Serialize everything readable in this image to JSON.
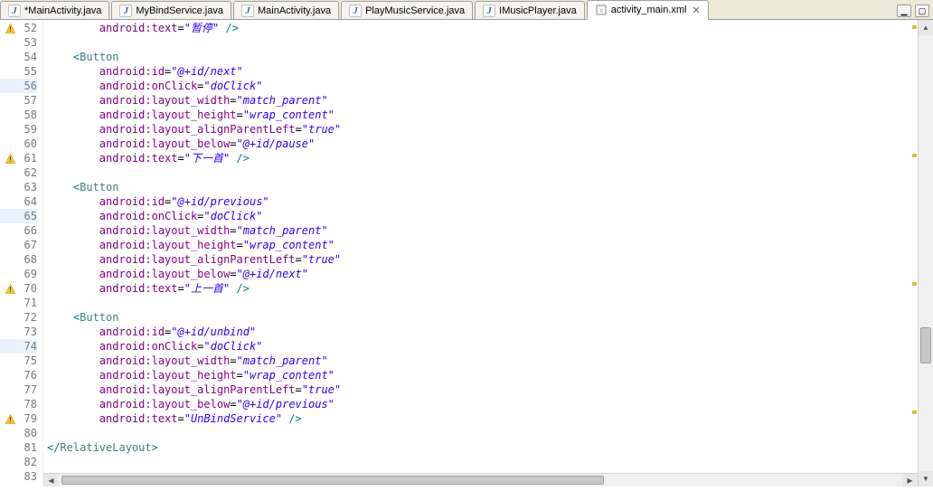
{
  "tabs": [
    {
      "label": "*MainActivity.java",
      "icon": "J",
      "active": false
    },
    {
      "label": "MyBindService.java",
      "icon": "J",
      "active": false
    },
    {
      "label": "MainActivity.java",
      "icon": "J",
      "active": false
    },
    {
      "label": "PlayMusicService.java",
      "icon": "J",
      "active": false
    },
    {
      "label": "IMusicPlayer.java",
      "icon": "J",
      "active": false
    },
    {
      "label": "activity_main.xml",
      "icon": "xml",
      "active": true
    }
  ],
  "gutter": {
    "start": 52,
    "end": 83,
    "warnings": [
      52,
      61,
      70,
      79
    ],
    "highlighted": [
      56,
      65,
      74
    ]
  },
  "code_lines": [
    {
      "n": 52,
      "indent": 8,
      "tokens": [
        [
          "attr",
          "android:text"
        ],
        [
          "eq",
          "="
        ],
        [
          "str",
          "\"暂停\""
        ],
        [
          "brk",
          " />"
        ]
      ]
    },
    {
      "n": 53,
      "indent": 0,
      "tokens": []
    },
    {
      "n": 54,
      "indent": 4,
      "tokens": [
        [
          "brk",
          "<"
        ],
        [
          "tag",
          "Button"
        ]
      ]
    },
    {
      "n": 55,
      "indent": 8,
      "tokens": [
        [
          "attr",
          "android:id"
        ],
        [
          "eq",
          "="
        ],
        [
          "str",
          "\"@+id/next\""
        ]
      ]
    },
    {
      "n": 56,
      "indent": 8,
      "tokens": [
        [
          "attr",
          "android:onClick"
        ],
        [
          "eq",
          "="
        ],
        [
          "str",
          "\"doClick\""
        ]
      ]
    },
    {
      "n": 57,
      "indent": 8,
      "tokens": [
        [
          "attr",
          "android:layout_width"
        ],
        [
          "eq",
          "="
        ],
        [
          "str",
          "\"match_parent\""
        ]
      ]
    },
    {
      "n": 58,
      "indent": 8,
      "tokens": [
        [
          "attr",
          "android:layout_height"
        ],
        [
          "eq",
          "="
        ],
        [
          "str",
          "\"wrap_content\""
        ]
      ]
    },
    {
      "n": 59,
      "indent": 8,
      "tokens": [
        [
          "attr",
          "android:layout_alignParentLeft"
        ],
        [
          "eq",
          "="
        ],
        [
          "str",
          "\"true\""
        ]
      ]
    },
    {
      "n": 60,
      "indent": 8,
      "tokens": [
        [
          "attr",
          "android:layout_below"
        ],
        [
          "eq",
          "="
        ],
        [
          "str",
          "\"@+id/pause\""
        ]
      ]
    },
    {
      "n": 61,
      "indent": 8,
      "tokens": [
        [
          "attr",
          "android:text"
        ],
        [
          "eq",
          "="
        ],
        [
          "str",
          "\"下一首\""
        ],
        [
          "brk",
          " />"
        ]
      ]
    },
    {
      "n": 62,
      "indent": 0,
      "tokens": []
    },
    {
      "n": 63,
      "indent": 4,
      "tokens": [
        [
          "brk",
          "<"
        ],
        [
          "tag",
          "Button"
        ]
      ]
    },
    {
      "n": 64,
      "indent": 8,
      "tokens": [
        [
          "attr",
          "android:id"
        ],
        [
          "eq",
          "="
        ],
        [
          "str",
          "\"@+id/previous\""
        ]
      ]
    },
    {
      "n": 65,
      "indent": 8,
      "tokens": [
        [
          "attr",
          "android:onClick"
        ],
        [
          "eq",
          "="
        ],
        [
          "str",
          "\"doClick\""
        ]
      ]
    },
    {
      "n": 66,
      "indent": 8,
      "tokens": [
        [
          "attr",
          "android:layout_width"
        ],
        [
          "eq",
          "="
        ],
        [
          "str",
          "\"match_parent\""
        ]
      ]
    },
    {
      "n": 67,
      "indent": 8,
      "tokens": [
        [
          "attr",
          "android:layout_height"
        ],
        [
          "eq",
          "="
        ],
        [
          "str",
          "\"wrap_content\""
        ]
      ]
    },
    {
      "n": 68,
      "indent": 8,
      "tokens": [
        [
          "attr",
          "android:layout_alignParentLeft"
        ],
        [
          "eq",
          "="
        ],
        [
          "str",
          "\"true\""
        ]
      ]
    },
    {
      "n": 69,
      "indent": 8,
      "tokens": [
        [
          "attr",
          "android:layout_below"
        ],
        [
          "eq",
          "="
        ],
        [
          "str",
          "\"@+id/next\""
        ]
      ]
    },
    {
      "n": 70,
      "indent": 8,
      "tokens": [
        [
          "attr",
          "android:text"
        ],
        [
          "eq",
          "="
        ],
        [
          "str",
          "\"上一首\""
        ],
        [
          "brk",
          " />"
        ]
      ]
    },
    {
      "n": 71,
      "indent": 0,
      "tokens": []
    },
    {
      "n": 72,
      "indent": 4,
      "tokens": [
        [
          "brk",
          "<"
        ],
        [
          "tag",
          "Button"
        ]
      ]
    },
    {
      "n": 73,
      "indent": 8,
      "tokens": [
        [
          "attr",
          "android:id"
        ],
        [
          "eq",
          "="
        ],
        [
          "str",
          "\"@+id/unbind\""
        ]
      ]
    },
    {
      "n": 74,
      "indent": 8,
      "tokens": [
        [
          "attr",
          "android:onClick"
        ],
        [
          "eq",
          "="
        ],
        [
          "str",
          "\"doClick\""
        ]
      ]
    },
    {
      "n": 75,
      "indent": 8,
      "tokens": [
        [
          "attr",
          "android:layout_width"
        ],
        [
          "eq",
          "="
        ],
        [
          "str",
          "\"match_parent\""
        ]
      ]
    },
    {
      "n": 76,
      "indent": 8,
      "tokens": [
        [
          "attr",
          "android:layout_height"
        ],
        [
          "eq",
          "="
        ],
        [
          "str",
          "\"wrap_content\""
        ]
      ]
    },
    {
      "n": 77,
      "indent": 8,
      "tokens": [
        [
          "attr",
          "android:layout_alignParentLeft"
        ],
        [
          "eq",
          "="
        ],
        [
          "str",
          "\"true\""
        ]
      ]
    },
    {
      "n": 78,
      "indent": 8,
      "tokens": [
        [
          "attr",
          "android:layout_below"
        ],
        [
          "eq",
          "="
        ],
        [
          "str",
          "\"@+id/previous\""
        ]
      ]
    },
    {
      "n": 79,
      "indent": 8,
      "tokens": [
        [
          "attr",
          "android:text"
        ],
        [
          "eq",
          "="
        ],
        [
          "str",
          "\"UnBindService\""
        ],
        [
          "brk",
          " />"
        ]
      ]
    },
    {
      "n": 80,
      "indent": 0,
      "tokens": []
    },
    {
      "n": 81,
      "indent": 0,
      "tokens": [
        [
          "brk",
          "</"
        ],
        [
          "tag",
          "RelativeLayout"
        ],
        [
          "brk",
          ">"
        ]
      ]
    },
    {
      "n": 82,
      "indent": 0,
      "tokens": []
    },
    {
      "n": 83,
      "indent": 0,
      "tokens": []
    }
  ]
}
